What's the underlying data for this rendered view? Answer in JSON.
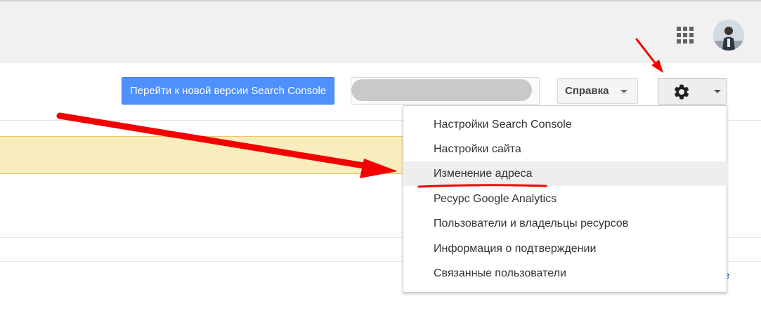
{
  "header": {
    "apps_icon": "apps-grid-icon",
    "avatar_icon": "user-avatar"
  },
  "toolbar": {
    "new_version_label": "Перейти к новой версии Search Console",
    "help_label": "Справка",
    "settings_icon": "gear-icon"
  },
  "settings_menu": {
    "items": [
      {
        "label": "Настройки Search Console"
      },
      {
        "label": "Настройки сайта"
      },
      {
        "label": "Изменение адреса",
        "highlighted": true
      },
      {
        "label": "Ресурс Google Analytics"
      },
      {
        "label": "Пользователи и владельцы ресурсов"
      },
      {
        "label": "Информация о подтверждении"
      },
      {
        "label": "Связанные пользователи"
      }
    ]
  },
  "partial_link_text": "e",
  "colors": {
    "primary_button": "#4d90fe",
    "alert_background": "#f9edbe",
    "annotation": "#ff0000",
    "menu_highlight": "#eeeeee"
  }
}
